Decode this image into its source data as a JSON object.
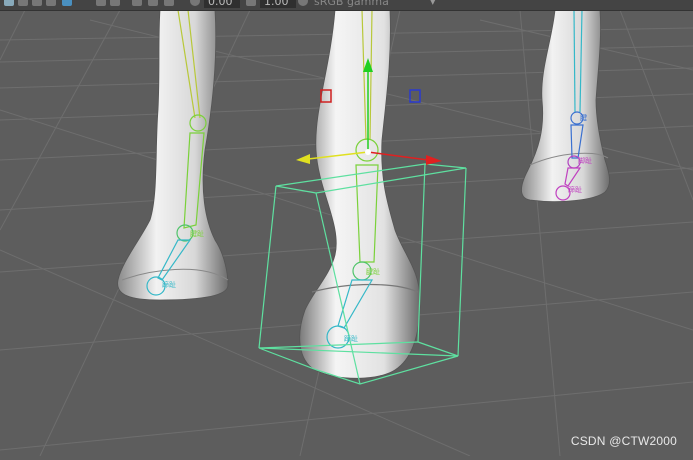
{
  "toolbar": {
    "field1_value": "0.00",
    "field2_value": "1.00",
    "colorspace_label": "sRGB gamma",
    "icons": [
      "camera-icon",
      "layers-icon",
      "wireframe-icon",
      "shaded-icon",
      "select-icon",
      "grid-icon",
      "snap-icon",
      "frame-icon",
      "exposure-icon",
      "gamma-icon",
      "colorspace-icon",
      "dropdown-icon"
    ]
  },
  "viewport": {
    "bone_labels": {
      "left_mid": "腱趾",
      "left_low": "蹄趾",
      "center_mid": "腱趾",
      "center_low": "蹄趾",
      "right_mid": "腱",
      "right_a": "脚趾",
      "right_b": "蹄趾"
    },
    "colors": {
      "background": "#5d5d5d",
      "grid": "#6a6a6a",
      "selection_box": "#5ee0a0",
      "axis_x": "#e02020",
      "axis_y": "#20d020",
      "axis_z": "#e0e020",
      "bone_green": "#7ad13a",
      "bone_cyan": "#35b8c8",
      "bone_magenta": "#c040c0",
      "bone_blue": "#3a70d0"
    }
  },
  "watermark": "CSDN @CTW2000"
}
